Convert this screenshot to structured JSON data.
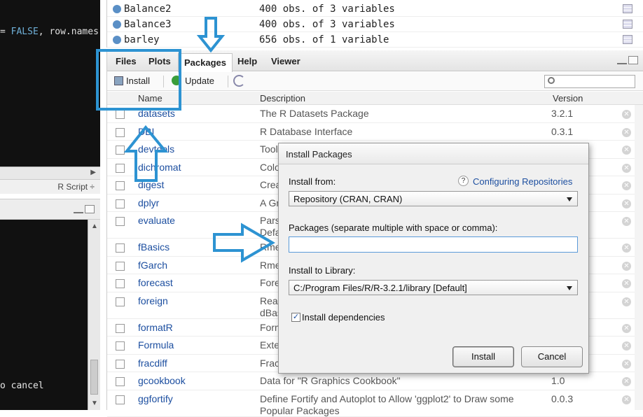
{
  "editor": {
    "code_false": "FALSE",
    "code_rest": ", row.names",
    "lang_label": "R Script ÷"
  },
  "console": {
    "text": "o cancel"
  },
  "environment": {
    "rows": [
      {
        "name": "Balance2",
        "value": "400 obs. of 3 variables"
      },
      {
        "name": "Balance3",
        "value": "400 obs. of 3 variables"
      },
      {
        "name": "barley",
        "value": "656 obs. of 1 variable"
      }
    ]
  },
  "tabs": [
    {
      "label": "Files"
    },
    {
      "label": "Plots"
    },
    {
      "label": "Packages"
    },
    {
      "label": "Help"
    },
    {
      "label": "Viewer"
    }
  ],
  "toolbar": {
    "install_label": "Install",
    "update_label": "Update"
  },
  "columns": {
    "name": "Name",
    "description": "Description",
    "version": "Version"
  },
  "packages": [
    {
      "name": "datasets",
      "desc": "The R Datasets Package",
      "version": "3.2.1"
    },
    {
      "name": "DBI",
      "desc": "R Database Interface",
      "version": "0.3.1"
    },
    {
      "name": "devtools",
      "desc": "Tool",
      "version": ""
    },
    {
      "name": "dichromat",
      "desc": "Colo",
      "version": ""
    },
    {
      "name": "digest",
      "desc": "Crea",
      "version": ""
    },
    {
      "name": "dplyr",
      "desc": "A Gr",
      "version": ""
    },
    {
      "name": "evaluate",
      "desc": "Pars\nDefa",
      "version": ""
    },
    {
      "name": "fBasics",
      "desc": "Rme",
      "version": ""
    },
    {
      "name": "fGarch",
      "desc": "Rme",
      "version": ""
    },
    {
      "name": "forecast",
      "desc": "Fore",
      "version": ""
    },
    {
      "name": "foreign",
      "desc": "Read\ndBas",
      "version": ""
    },
    {
      "name": "formatR",
      "desc": "Form",
      "version": ""
    },
    {
      "name": "Formula",
      "desc": "Exte",
      "version": ""
    },
    {
      "name": "fracdiff",
      "desc": "Frac",
      "version": ""
    },
    {
      "name": "gcookbook",
      "desc": "Data for \"R Graphics Cookbook\"",
      "version": "1.0"
    },
    {
      "name": "ggfortify",
      "desc": "Define Fortify and Autoplot to Allow 'ggplot2' to Draw some\nPopular Packages",
      "version": "0.0.3"
    }
  ],
  "dialog": {
    "title": "Install Packages",
    "install_from_label": "Install from:",
    "help_icon": "?",
    "help_link": "Configuring Repositories",
    "install_from_value": "Repository (CRAN, CRAN)",
    "packages_label": "Packages (separate multiple with space or comma):",
    "packages_value": "",
    "library_label": "Install to Library:",
    "library_value": "C:/Program Files/R/R-3.2.1/library [Default]",
    "dependencies_label": "Install dependencies",
    "dependencies_checked": true,
    "install_button": "Install",
    "cancel_button": "Cancel"
  },
  "colors": {
    "annotation": "#2d93d2",
    "link": "#1d4fa0"
  }
}
